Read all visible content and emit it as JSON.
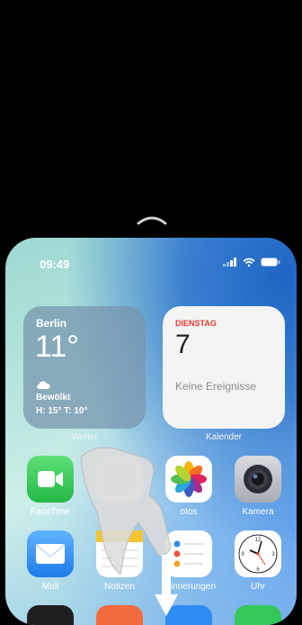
{
  "status": {
    "time": "09:49"
  },
  "widgets": {
    "weather": {
      "city": "Berlin",
      "temp": "11°",
      "condition": "Bewölkt",
      "hilo": "H: 15° T: 10°",
      "label": "Wetter"
    },
    "calendar": {
      "day": "DIENSTAG",
      "date": "7",
      "events": "Keine Ereignisse",
      "label": "Kalender"
    }
  },
  "apps_row1": [
    {
      "label": "FaceTime",
      "icon": "facetime-icon"
    },
    {
      "label": "",
      "icon": "app-icon"
    },
    {
      "label": "otos",
      "icon": "photos-icon"
    },
    {
      "label": "Kamera",
      "icon": "camera-icon"
    }
  ],
  "apps_row2": [
    {
      "label": "Mail",
      "icon": "mail-icon"
    },
    {
      "label": "Notizen",
      "icon": "notes-icon"
    },
    {
      "label": "Erinnerungen",
      "icon": "reminders-icon"
    },
    {
      "label": "Uhr",
      "icon": "clock-icon"
    }
  ],
  "colors": {
    "calendar_red": "#e03b33",
    "facetime_green": "#30c94e",
    "mail_blue": "#2f8cf3"
  }
}
